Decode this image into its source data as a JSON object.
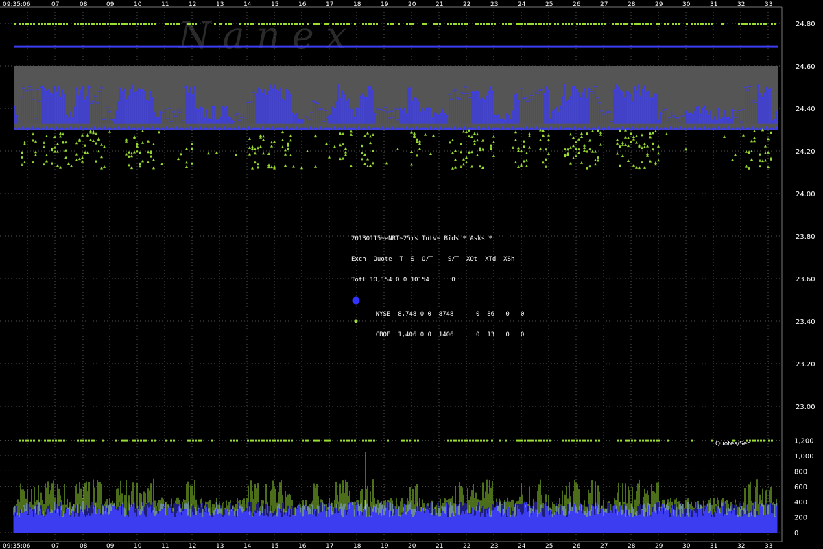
{
  "watermark": "N a n e x",
  "x_tick_labels": [
    "09:35:06",
    "07",
    "08",
    "09",
    "10",
    "11",
    "12",
    "13",
    "14",
    "15",
    "16",
    "17",
    "18",
    "19",
    "20",
    "21",
    "22",
    "23",
    "24",
    "25",
    "26",
    "27",
    "28",
    "29",
    "30",
    "31",
    "32",
    "33"
  ],
  "legend": {
    "title": "20130115~eNRT~25ms Intv~ Bids * Asks *",
    "header": "Exch  Quote  T  S  Q/T    S/T  XQt  XTd  XSh",
    "total": "Totl 10,154 0 0 10154      0",
    "rows": [
      {
        "text": "NYSE  8,748 0 0  8748      0  86   0   0",
        "color": "#3333ff",
        "marker": "big-dot"
      },
      {
        "text": "CBOE  1,406 0 0  1406      0  13   0   0",
        "color": "#99dd33",
        "marker": "small-dot"
      }
    ]
  },
  "qps_title": "Quotes/Sec",
  "colors": {
    "nyse": "#3c3cf0",
    "cboe": "#99dd33",
    "band": "#555555",
    "grid": "#555555",
    "text": "#ffffff"
  },
  "chart_data": [
    {
      "type": "scatter",
      "title": "20130115~eNRT~25ms Intv~ Bids * Asks *",
      "ylim": [
        22.9,
        24.85
      ],
      "y_ticks": [
        "24.80",
        "24.60",
        "24.40",
        "24.20",
        "24.00",
        "23.80",
        "23.60",
        "23.40",
        "23.20",
        "23.00"
      ],
      "grid": true,
      "series": [
        {
          "name": "NYSE",
          "reference_price": 24.69,
          "bid_range": [
            24.33,
            24.51
          ],
          "bid_floor": 24.31
        },
        {
          "name": "CBOE",
          "ask_level": 24.8,
          "bid_range": [
            24.12,
            24.3
          ]
        }
      ],
      "nbbo_band": [
        24.3,
        24.6
      ]
    },
    {
      "type": "bar",
      "title": "Quotes/Sec",
      "ylim": [
        0,
        1200
      ],
      "y_ticks": [
        "1,200",
        "1,000",
        "800",
        "600",
        "400",
        "200",
        "0"
      ],
      "series": [
        {
          "name": "NYSE",
          "typical_range": [
            200,
            400
          ]
        },
        {
          "name": "CBOE",
          "typical_range": [
            300,
            700
          ],
          "max": 1050
        }
      ]
    }
  ]
}
